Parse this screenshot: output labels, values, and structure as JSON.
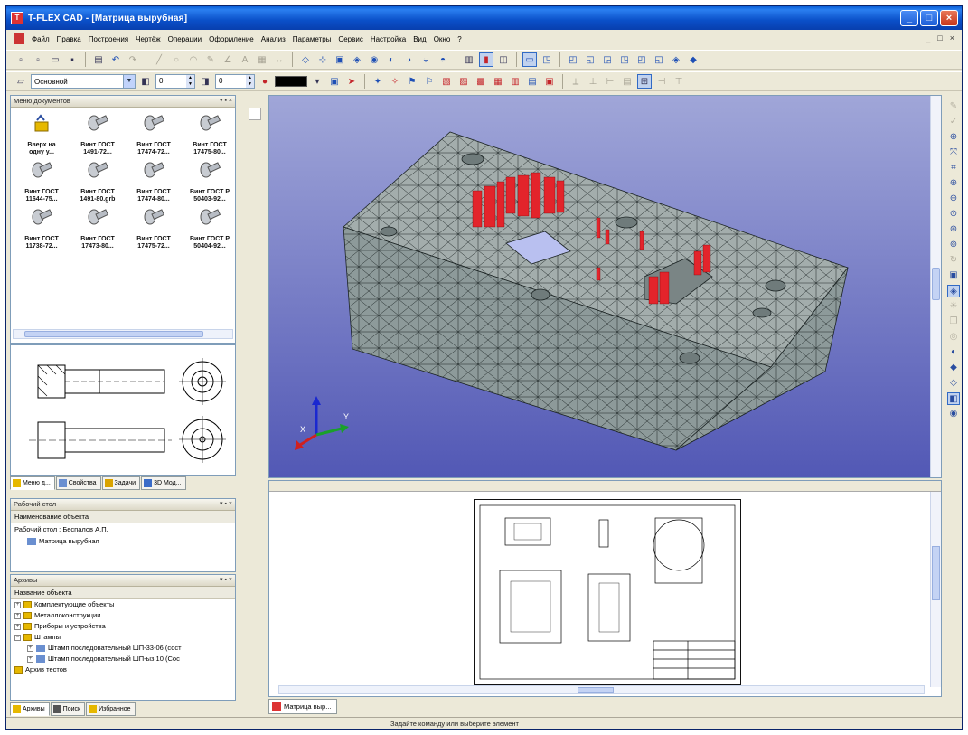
{
  "window": {
    "title": "T-FLEX CAD - [Матрица вырубная]",
    "buttons": {
      "minimize": "_",
      "maximize": "□",
      "close": "×"
    }
  },
  "menu": {
    "items": [
      "Файл",
      "Правка",
      "Построения",
      "Чертёж",
      "Операции",
      "Оформление",
      "Анализ",
      "Параметры",
      "Сервис",
      "Настройка",
      "Вид",
      "Окно",
      "?"
    ],
    "mdi": [
      "_",
      "□",
      "×"
    ]
  },
  "toolbar2": {
    "layer_combo": "Основной",
    "spin1": "0",
    "spin2": "0"
  },
  "library_panel": {
    "header": "Меню документов",
    "items": [
      {
        "line1": "Вверх на",
        "line2": "одну у..."
      },
      {
        "line1": "Винт ГОСТ",
        "line2": "1491-72..."
      },
      {
        "line1": "Винт ГОСТ",
        "line2": "17474-72..."
      },
      {
        "line1": "Винт ГОСТ",
        "line2": "17475-80..."
      },
      {
        "line1": "Винт ГОСТ",
        "line2": "11644-75..."
      },
      {
        "line1": "Винт ГОСТ",
        "line2": "1491-80.grb"
      },
      {
        "line1": "Винт ГОСТ",
        "line2": "17474-80..."
      },
      {
        "line1": "Винт ГОСТ Р",
        "line2": "50403-92..."
      },
      {
        "line1": "Винт ГОСТ",
        "line2": "11738-72..."
      },
      {
        "line1": "Винт ГОСТ",
        "line2": "17473-80..."
      },
      {
        "line1": "Винт ГОСТ",
        "line2": "17475-72..."
      },
      {
        "line1": "Винт ГОСТ Р",
        "line2": "50404-92..."
      }
    ]
  },
  "left_tabs": [
    "Меню д...",
    "Свойства",
    "Задачи",
    "3D Мод..."
  ],
  "desk_panel": {
    "header": "Рабочий стол",
    "column": "Наименование объекта",
    "rows": [
      "Рабочий стол : Беспалов А.П.",
      "Матрица вырубная"
    ]
  },
  "archive_panel": {
    "header": "Архивы",
    "column": "Название объекта",
    "rows": [
      "Комплектующие объекты",
      "Металлоконструкции",
      "Приборы и устройства",
      "Штампы",
      "Штамп последовательный ШП-33-06 (сост",
      "Штамп последовательный ШП-ыз 10 (Сос",
      "Архив тестов"
    ]
  },
  "bottom_tabs": [
    "Архивы",
    "Поиск",
    "Избранное"
  ],
  "doc_tab": "Матрица выр...",
  "status": "Задайте команду или выберите элемент",
  "colors": {
    "mesh_face": "#8d9a9a",
    "mesh_top": "#a3adac",
    "highlight": "#e3242b",
    "viewport_top": "#a0a6d8",
    "viewport_bottom": "#5258b5"
  },
  "axes": {
    "x": "X",
    "y": "Y"
  }
}
